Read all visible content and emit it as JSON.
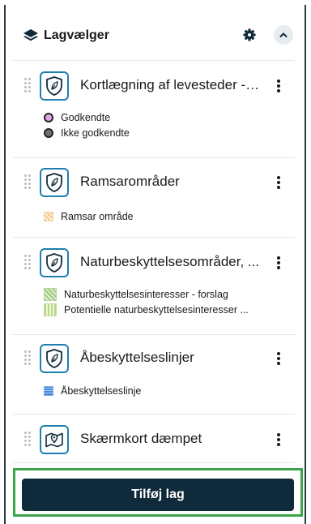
{
  "header": {
    "title": "Lagvælger",
    "icons": {
      "layers": "layers-icon",
      "settings": "gear-icon",
      "collapse": "chevron-up-icon"
    }
  },
  "layers": [
    {
      "name": "Kortlægning af levesteder - kortlægning",
      "display_name": "Kortlægning af levesteder - ...",
      "icon": "leaf-shield-icon",
      "legend": [
        {
          "label": "Godkendte",
          "swatch": "circle",
          "color": "#e2a6e8"
        },
        {
          "label": "Ikke godkendte",
          "swatch": "circle",
          "color": "#6f6f6f"
        }
      ]
    },
    {
      "name": "Ramsarområder",
      "display_name": "Ramsarområder",
      "icon": "leaf-shield-icon",
      "legend": [
        {
          "label": "Ramsar område",
          "swatch": "hatch",
          "color": "#f3c88a"
        }
      ]
    },
    {
      "name": "Naturbeskyttelsesområder, ...",
      "display_name": "Naturbeskyttelsesområder, ...",
      "icon": "leaf-shield-icon",
      "legend": [
        {
          "label": "Naturbeskyttelsesinteresser - forslag",
          "swatch": "hatch",
          "color": "#9cc77a"
        },
        {
          "label": "Potentielle naturbeskyttelsesinteresser ...",
          "swatch": "vlines",
          "color": "#b7d77f"
        }
      ]
    },
    {
      "name": "Åbeskyttelseslinjer",
      "display_name": "Åbeskyttelseslinjer",
      "icon": "leaf-shield-icon",
      "legend": [
        {
          "label": "Åbeskyttelseslinje",
          "swatch": "hlines",
          "color": "#3f83d8"
        }
      ]
    },
    {
      "name": "Skærmkort dæmpet",
      "display_name": "Skærmkort dæmpet",
      "icon": "map-pin-icon",
      "legend": []
    }
  ],
  "footer": {
    "add_layer_label": "Tilføj lag"
  },
  "colors": {
    "accent": "#1d7fae",
    "button_bg": "#0f2a3a",
    "highlight": "#3aa44a"
  }
}
